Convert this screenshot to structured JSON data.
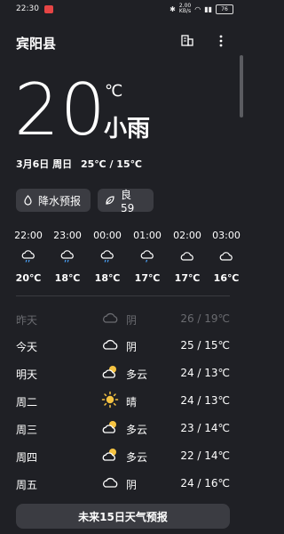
{
  "status": {
    "time": "22:30",
    "battery": "76",
    "net_speed": "2.00",
    "net_unit": "KB/s"
  },
  "header": {
    "city": "宾阳县"
  },
  "current": {
    "temp": "20",
    "unit": "℃",
    "condition": "小雨",
    "date": "3月6日 周日",
    "range": "25℃ / 15℃"
  },
  "chips": {
    "rain": "降水预报",
    "aqi": "良 59"
  },
  "hourly": [
    {
      "time": "22:00",
      "temp": "20℃",
      "icon": "rain-cloud-icon"
    },
    {
      "time": "23:00",
      "temp": "18℃",
      "icon": "rain-cloud-icon"
    },
    {
      "time": "00:00",
      "temp": "18℃",
      "icon": "rain-cloud-icon"
    },
    {
      "time": "01:00",
      "temp": "17℃",
      "icon": "rain-cloud-icon"
    },
    {
      "time": "02:00",
      "temp": "17℃",
      "icon": "cloud-icon"
    },
    {
      "time": "03:00",
      "temp": "16℃",
      "icon": "cloud-icon"
    }
  ],
  "daily": [
    {
      "day": "昨天",
      "cond": "阴",
      "range": "26 / 19℃",
      "icon": "cloud-icon"
    },
    {
      "day": "今天",
      "cond": "阴",
      "range": "25 / 15℃",
      "icon": "cloud-icon"
    },
    {
      "day": "明天",
      "cond": "多云",
      "range": "24 / 13℃",
      "icon": "partly-cloudy-icon"
    },
    {
      "day": "周二",
      "cond": "晴",
      "range": "24 / 13℃",
      "icon": "sun-icon"
    },
    {
      "day": "周三",
      "cond": "多云",
      "range": "23 / 14℃",
      "icon": "partly-cloudy-icon"
    },
    {
      "day": "周四",
      "cond": "多云",
      "range": "22 / 14℃",
      "icon": "partly-cloudy-icon"
    },
    {
      "day": "周五",
      "cond": "阴",
      "range": "24 / 16℃",
      "icon": "cloud-icon"
    }
  ],
  "footer": {
    "forecast_button": "未来15日天气预报"
  },
  "colors": {
    "background": "#1f2025",
    "chip": "#3b3c42",
    "sun": "#f5c342"
  }
}
